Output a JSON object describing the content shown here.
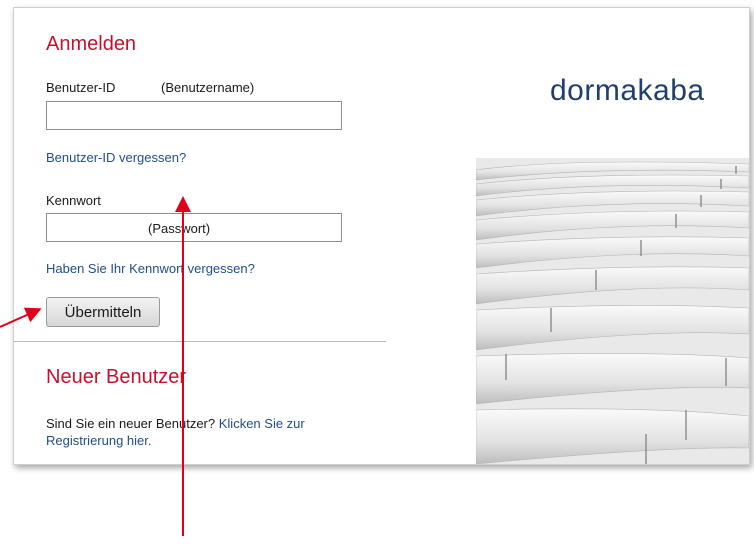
{
  "login": {
    "title": "Anmelden",
    "user_id_label": "Benutzer-ID",
    "user_id_hint": "(Benutzername)",
    "user_id_value": "",
    "forgot_user_id": "Benutzer-ID vergessen?",
    "password_label": "Kennwort",
    "password_hint": "(Passwort)",
    "forgot_password": "Haben Sie Ihr Kennwort vergessen?",
    "submit_label": "Übermitteln"
  },
  "new_user": {
    "title": "Neuer Benutzer",
    "text": "Sind Sie ein neuer Benutzer?",
    "link": "Klicken Sie zur Registrierung hier."
  },
  "brand": {
    "name": "dormakaba"
  },
  "colors": {
    "heading": "#c8102e",
    "link": "#1f4e8c",
    "brand": "#1f3f6e",
    "annotation_arrow": "#e0001b"
  }
}
